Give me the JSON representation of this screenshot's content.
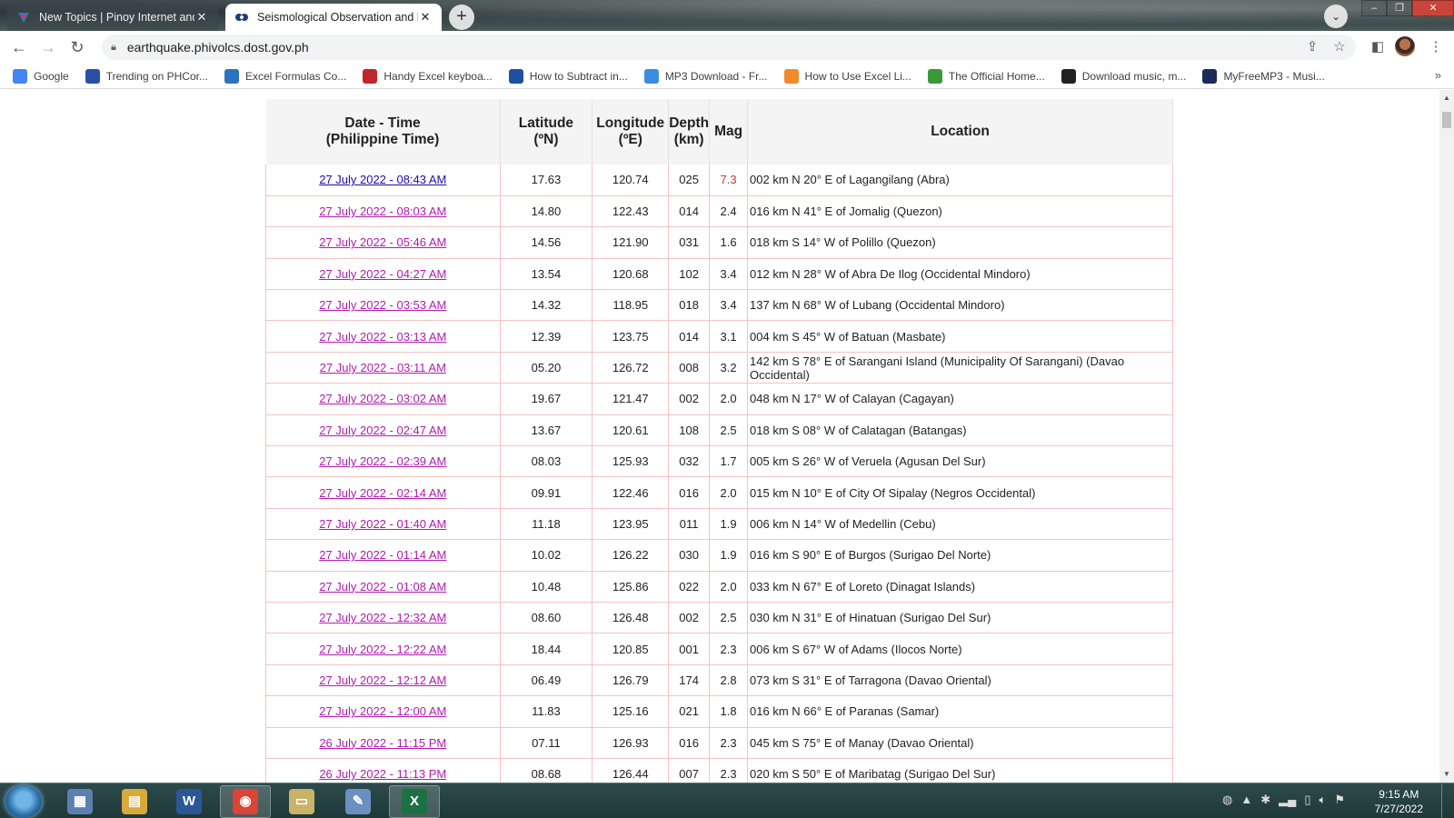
{
  "browser": {
    "tabs": [
      {
        "title": "New Topics | Pinoy Internet and T",
        "icon": "pinoy-site-icon",
        "active": false
      },
      {
        "title": "Seismological Observation and E",
        "icon": "phivolcs-icon",
        "active": true
      }
    ],
    "new_tab": "+",
    "url": "earthquake.phivolcs.dost.gov.ph",
    "bookmarks": [
      {
        "label": "Google",
        "icon": "google-icon",
        "color": "#4285f4"
      },
      {
        "label": "Trending on PHCor...",
        "icon": "phcorner-icon",
        "color": "#2a4fa8"
      },
      {
        "label": "Excel Formulas Co...",
        "icon": "excel-formulas-icon",
        "color": "#2a73c0"
      },
      {
        "label": "Handy Excel keyboa...",
        "icon": "handy-excel-icon",
        "color": "#c0262b"
      },
      {
        "label": "How to Subtract in...",
        "icon": "subtract-icon",
        "color": "#1f4fa0"
      },
      {
        "label": "MP3 Download - Fr...",
        "icon": "mp3-icon",
        "color": "#3a8ee0"
      },
      {
        "label": "How to Use Excel Li...",
        "icon": "excel-li-icon",
        "color": "#f08a2a"
      },
      {
        "label": "The Official Home...",
        "icon": "official-home-icon",
        "color": "#3a9a3a"
      },
      {
        "label": "Download music, m...",
        "icon": "download-music-icon",
        "color": "#222222"
      },
      {
        "label": "MyFreeMP3 - Musi...",
        "icon": "myfreemp3-icon",
        "color": "#1a2a5a"
      }
    ]
  },
  "table": {
    "headers": {
      "datetime": "Date - Time",
      "datetime_sub": "(Philippine Time)",
      "lat": "Latitude",
      "lat_sub": "(ºN)",
      "lon": "Longitude",
      "lon_sub": "(ºE)",
      "depth": "Depth",
      "depth_sub": "(km)",
      "mag": "Mag",
      "loc": "Location"
    },
    "rows": [
      {
        "dt": "27 July 2022 - 08:43 AM",
        "lat": "17.63",
        "lon": "120.74",
        "depth": "025",
        "mag": "7.3",
        "loc": "002 km N 20° E of Lagangilang (Abra)"
      },
      {
        "dt": "27 July 2022 - 08:03 AM",
        "lat": "14.80",
        "lon": "122.43",
        "depth": "014",
        "mag": "2.4",
        "loc": "016 km N 41° E of Jomalig (Quezon)"
      },
      {
        "dt": "27 July 2022 - 05:46 AM",
        "lat": "14.56",
        "lon": "121.90",
        "depth": "031",
        "mag": "1.6",
        "loc": "018 km S 14° W of Polillo (Quezon)"
      },
      {
        "dt": "27 July 2022 - 04:27 AM",
        "lat": "13.54",
        "lon": "120.68",
        "depth": "102",
        "mag": "3.4",
        "loc": "012 km N 28° W of Abra De Ilog (Occidental Mindoro)"
      },
      {
        "dt": "27 July 2022 - 03:53 AM",
        "lat": "14.32",
        "lon": "118.95",
        "depth": "018",
        "mag": "3.4",
        "loc": "137 km N 68° W of Lubang (Occidental Mindoro)"
      },
      {
        "dt": "27 July 2022 - 03:13 AM",
        "lat": "12.39",
        "lon": "123.75",
        "depth": "014",
        "mag": "3.1",
        "loc": "004 km S 45° W of Batuan (Masbate)"
      },
      {
        "dt": "27 July 2022 - 03:11 AM",
        "lat": "05.20",
        "lon": "126.72",
        "depth": "008",
        "mag": "3.2",
        "loc": "142 km S 78° E of Sarangani Island (Municipality Of Sarangani) (Davao Occidental)"
      },
      {
        "dt": "27 July 2022 - 03:02 AM",
        "lat": "19.67",
        "lon": "121.47",
        "depth": "002",
        "mag": "2.0",
        "loc": "048 km N 17° W of Calayan (Cagayan)"
      },
      {
        "dt": "27 July 2022 - 02:47 AM",
        "lat": "13.67",
        "lon": "120.61",
        "depth": "108",
        "mag": "2.5",
        "loc": "018 km S 08° W of Calatagan (Batangas)"
      },
      {
        "dt": "27 July 2022 - 02:39 AM",
        "lat": "08.03",
        "lon": "125.93",
        "depth": "032",
        "mag": "1.7",
        "loc": "005 km S 26° W of Veruela (Agusan Del Sur)"
      },
      {
        "dt": "27 July 2022 - 02:14 AM",
        "lat": "09.91",
        "lon": "122.46",
        "depth": "016",
        "mag": "2.0",
        "loc": "015 km N 10° E of City Of Sipalay (Negros Occidental)"
      },
      {
        "dt": "27 July 2022 - 01:40 AM",
        "lat": "11.18",
        "lon": "123.95",
        "depth": "011",
        "mag": "1.9",
        "loc": "006 km N 14° W of Medellin (Cebu)"
      },
      {
        "dt": "27 July 2022 - 01:14 AM",
        "lat": "10.02",
        "lon": "126.22",
        "depth": "030",
        "mag": "1.9",
        "loc": "016 km S 90° E of Burgos (Surigao Del Norte)"
      },
      {
        "dt": "27 July 2022 - 01:08 AM",
        "lat": "10.48",
        "lon": "125.86",
        "depth": "022",
        "mag": "2.0",
        "loc": "033 km N 67° E of Loreto (Dinagat Islands)"
      },
      {
        "dt": "27 July 2022 - 12:32 AM",
        "lat": "08.60",
        "lon": "126.48",
        "depth": "002",
        "mag": "2.5",
        "loc": "030 km N 31° E of Hinatuan (Surigao Del Sur)"
      },
      {
        "dt": "27 July 2022 - 12:22 AM",
        "lat": "18.44",
        "lon": "120.85",
        "depth": "001",
        "mag": "2.3",
        "loc": "006 km S 67° W of Adams (Ilocos Norte)"
      },
      {
        "dt": "27 July 2022 - 12:12 AM",
        "lat": "06.49",
        "lon": "126.79",
        "depth": "174",
        "mag": "2.8",
        "loc": "073 km S 31° E of Tarragona (Davao Oriental)"
      },
      {
        "dt": "27 July 2022 - 12:00 AM",
        "lat": "11.83",
        "lon": "125.16",
        "depth": "021",
        "mag": "1.8",
        "loc": "016 km N 66° E of Paranas (Samar)"
      },
      {
        "dt": "26 July 2022 - 11:15 PM",
        "lat": "07.11",
        "lon": "126.93",
        "depth": "016",
        "mag": "2.3",
        "loc": "045 km S 75° E of Manay (Davao Oriental)"
      },
      {
        "dt": "26 July 2022 - 11:13 PM",
        "lat": "08.68",
        "lon": "126.44",
        "depth": "007",
        "mag": "2.3",
        "loc": "020 km S 50° E of Maribatag (Surigao Del Sur)"
      }
    ]
  },
  "taskbar": {
    "apps": [
      {
        "name": "calculator",
        "glyph": "▦",
        "color": "#5b7fb0"
      },
      {
        "name": "file-explorer",
        "glyph": "▤",
        "color": "#d9a93a"
      },
      {
        "name": "word",
        "glyph": "W",
        "color": "#2b5797"
      },
      {
        "name": "chrome",
        "glyph": "◉",
        "color": "#db4437"
      },
      {
        "name": "folder",
        "glyph": "▭",
        "color": "#c9b26a"
      },
      {
        "name": "notepad",
        "glyph": "✎",
        "color": "#6a8fc0"
      },
      {
        "name": "excel",
        "glyph": "X",
        "color": "#1d7044"
      }
    ],
    "time": "9:15 AM",
    "date": "7/27/2022"
  }
}
